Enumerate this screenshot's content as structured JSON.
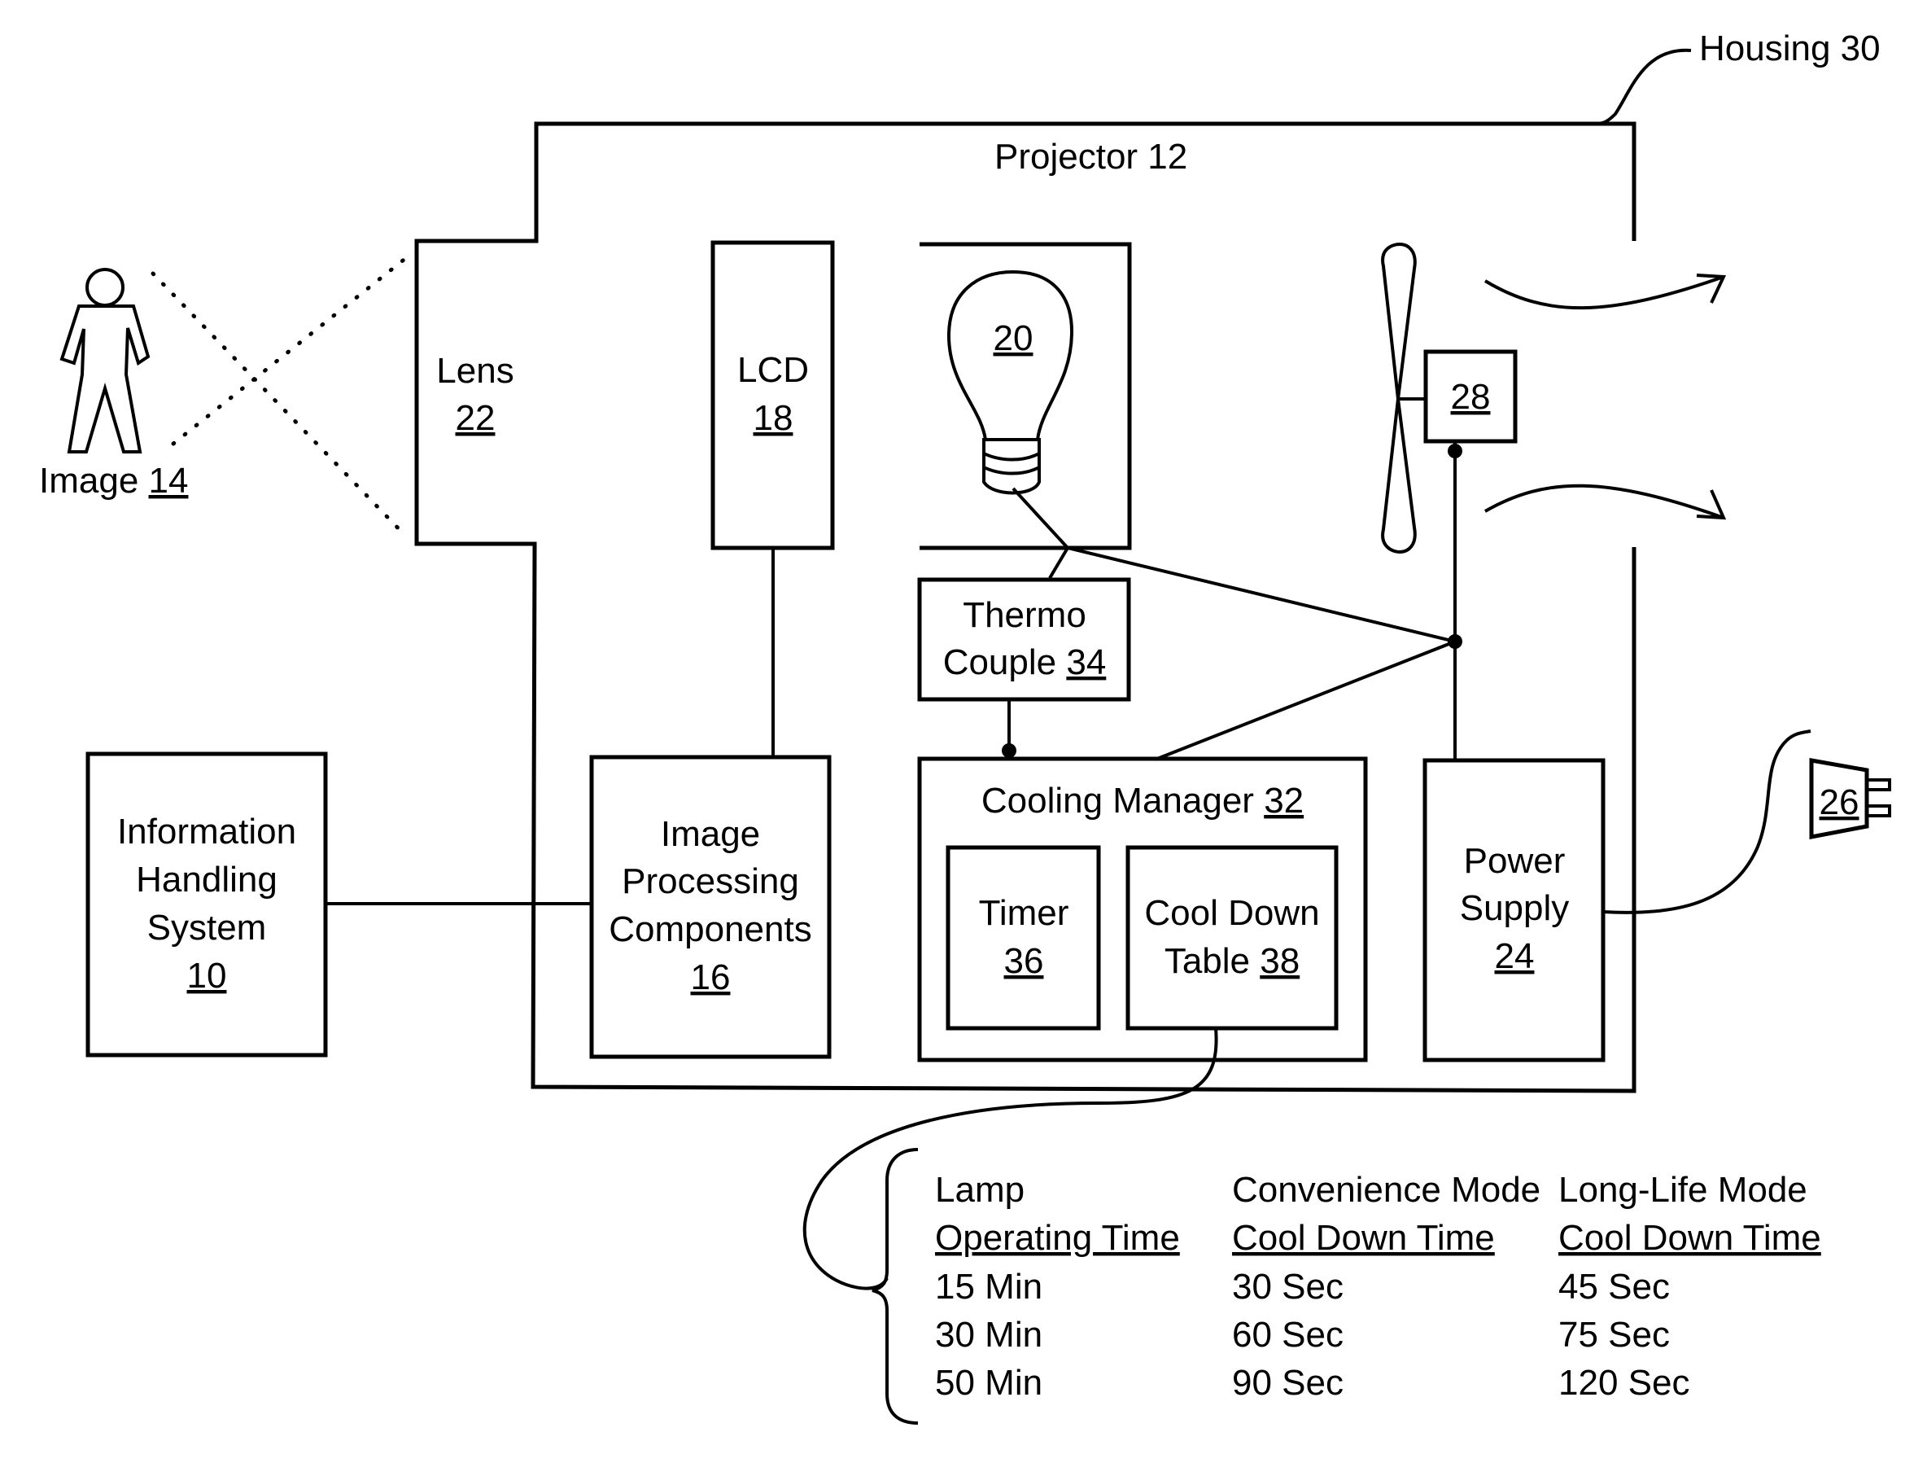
{
  "labels": {
    "housing": "Housing 30",
    "projector": "Projector 12",
    "image": "Image",
    "image_num": "14",
    "lens": "Lens",
    "lens_num": "22",
    "lcd": "LCD",
    "lcd_num": "18",
    "lamp_num": "20",
    "fan_motor_num": "28",
    "thermo_l1": "Thermo",
    "thermo_l2": "Couple",
    "thermo_num": "34",
    "ihs_l1": "Information",
    "ihs_l2": "Handling",
    "ihs_l3": "System",
    "ihs_num": "10",
    "ipc_l1": "Image",
    "ipc_l2": "Processing",
    "ipc_l3": "Components",
    "ipc_num": "16",
    "cooling_manager": "Cooling Manager",
    "cooling_manager_num": "32",
    "timer": "Timer",
    "timer_num": "36",
    "cdt_l1": "Cool Down",
    "cdt_l2": "Table",
    "cdt_num": "38",
    "ps_l1": "Power",
    "ps_l2": "Supply",
    "ps_num": "24",
    "plug_num": "26"
  },
  "cool_down_table": {
    "headers": [
      {
        "line1": "Lamp",
        "line2": "Operating Time"
      },
      {
        "line1": "Convenience Mode",
        "line2": "Cool Down Time"
      },
      {
        "line1": "Long-Life Mode",
        "line2": "Cool Down Time"
      }
    ],
    "rows": [
      [
        "15 Min",
        "30 Sec",
        "45 Sec"
      ],
      [
        "30 Min",
        "60 Sec",
        "75 Sec"
      ],
      [
        "50 Min",
        "90 Sec",
        "120 Sec"
      ]
    ]
  }
}
